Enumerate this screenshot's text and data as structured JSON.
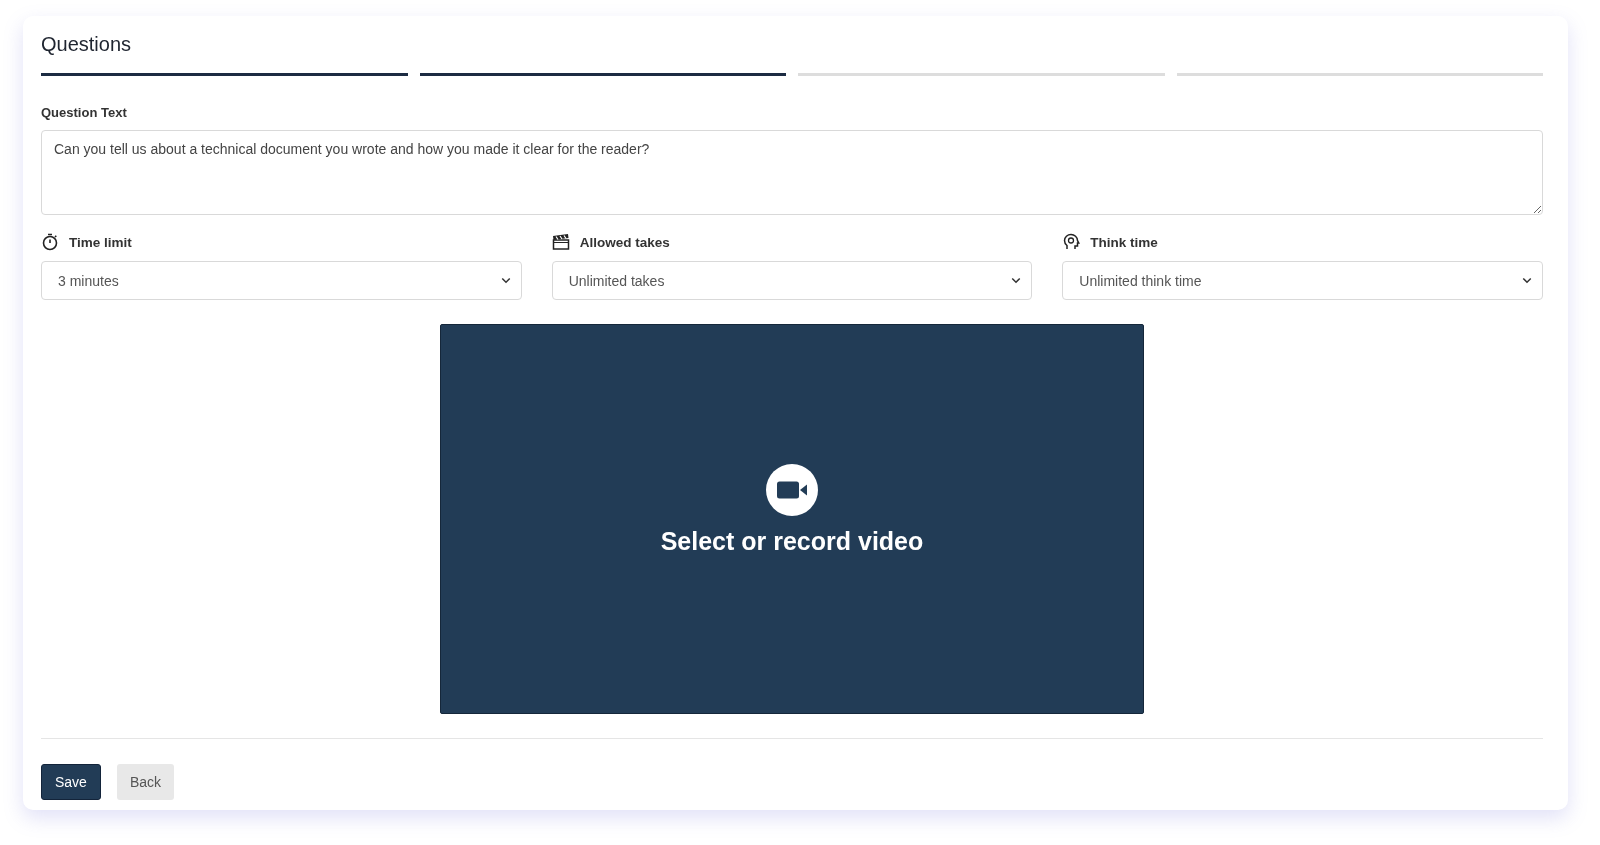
{
  "title": "Questions",
  "steps": [
    {
      "completed": true
    },
    {
      "completed": true
    },
    {
      "completed": false
    },
    {
      "completed": false
    }
  ],
  "question": {
    "label": "Question Text",
    "value": "Can you tell us about a technical document you wrote and how you made it clear for the reader?"
  },
  "settings": [
    {
      "kind": "timer",
      "label": "Time limit",
      "value": "3 minutes"
    },
    {
      "kind": "clapper",
      "label": "Allowed takes",
      "value": "Unlimited takes"
    },
    {
      "kind": "head",
      "label": "Think time",
      "value": "Unlimited think time"
    }
  ],
  "video": {
    "prompt": "Select or record video"
  },
  "buttons": [
    {
      "kind": "primary",
      "label": "Save"
    },
    {
      "kind": "secondary",
      "label": "Back"
    }
  ]
}
